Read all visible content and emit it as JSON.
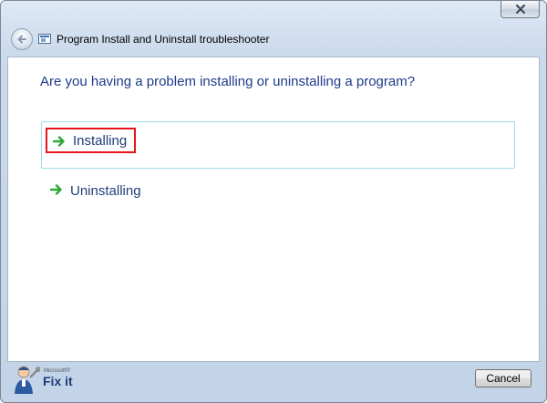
{
  "window": {
    "title": "Program Install and Uninstall troubleshooter"
  },
  "content": {
    "question": "Are you having a problem installing or uninstalling a program?",
    "options": [
      {
        "label": "Installing",
        "icon": "green-arrow-icon",
        "selected": true
      },
      {
        "label": "Uninstalling",
        "icon": "green-arrow-icon",
        "selected": false
      }
    ]
  },
  "footer": {
    "brand_small": "Microsoft®",
    "brand_big": "Fix it",
    "cancel_label": "Cancel"
  },
  "colors": {
    "question_text": "#1e3a8a",
    "option_text": "#1f3f7a",
    "highlight_border": "#e8141b",
    "selected_option_border": "#9fdceb",
    "arrow_green": "#2fa83a"
  }
}
